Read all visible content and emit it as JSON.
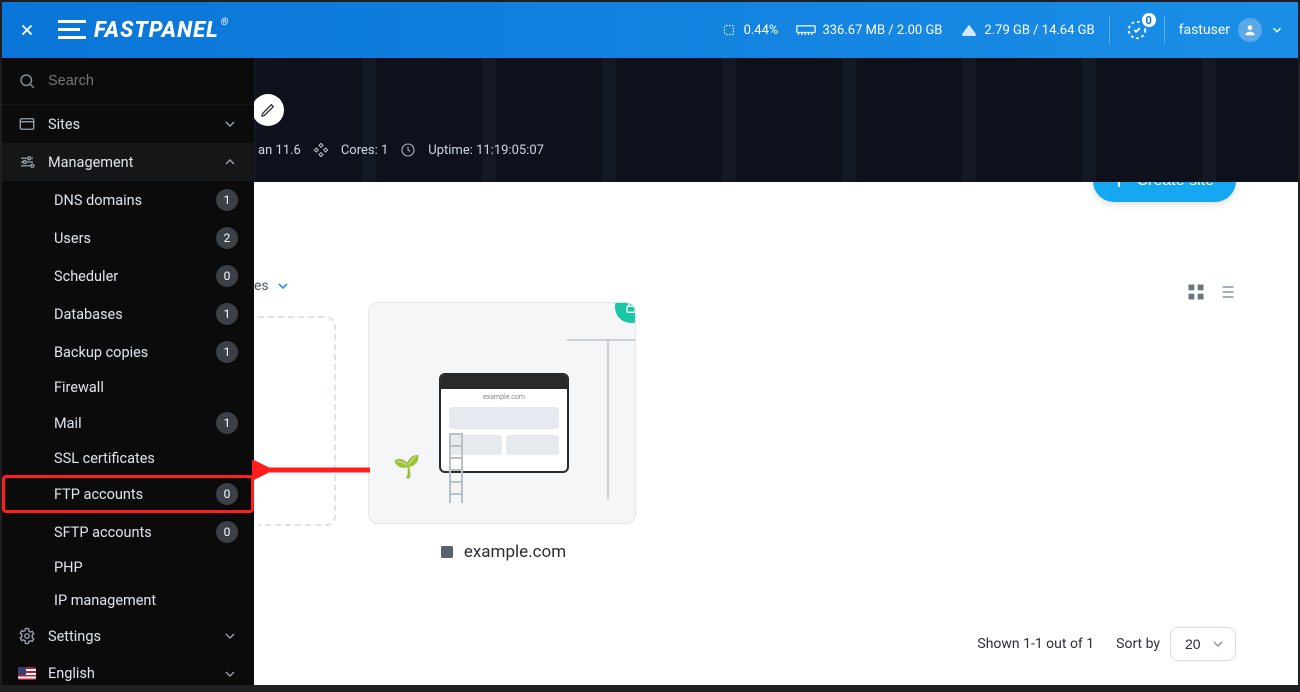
{
  "header": {
    "product_name": "FASTPANEL",
    "cpu_percent": "0.44%",
    "ram_text": "336.67 MB / 2.00 GB",
    "disk_text": "2.79 GB / 14.64 GB",
    "notifications_count": "0",
    "username": "fastuser"
  },
  "hero": {
    "os_fragment": "an 11.6",
    "cores_label": "Cores: 1",
    "uptime_label": "Uptime: 11:19:05:07"
  },
  "actions": {
    "create_site": "Create site"
  },
  "filters": {
    "truncated_label": "es"
  },
  "site": {
    "name": "example.com",
    "browser_title": "example.com"
  },
  "pagination": {
    "shown_text": "Shown 1-1 out of 1",
    "sort_label": "Sort by",
    "page_size_value": "20"
  },
  "sidebar": {
    "search_placeholder": "Search",
    "sites_label": "Sites",
    "management_label": "Management",
    "settings_label": "Settings",
    "language_label": "English",
    "items": [
      {
        "label": "DNS domains",
        "count": "1"
      },
      {
        "label": "Users",
        "count": "2"
      },
      {
        "label": "Scheduler",
        "count": "0"
      },
      {
        "label": "Databases",
        "count": "1"
      },
      {
        "label": "Backup copies",
        "count": "1"
      },
      {
        "label": "Firewall",
        "count": ""
      },
      {
        "label": "Mail",
        "count": "1"
      },
      {
        "label": "SSL certificates",
        "count": ""
      },
      {
        "label": "FTP accounts",
        "count": "0"
      },
      {
        "label": "SFTP accounts",
        "count": "0"
      },
      {
        "label": "PHP",
        "count": ""
      },
      {
        "label": "IP management",
        "count": ""
      }
    ]
  }
}
